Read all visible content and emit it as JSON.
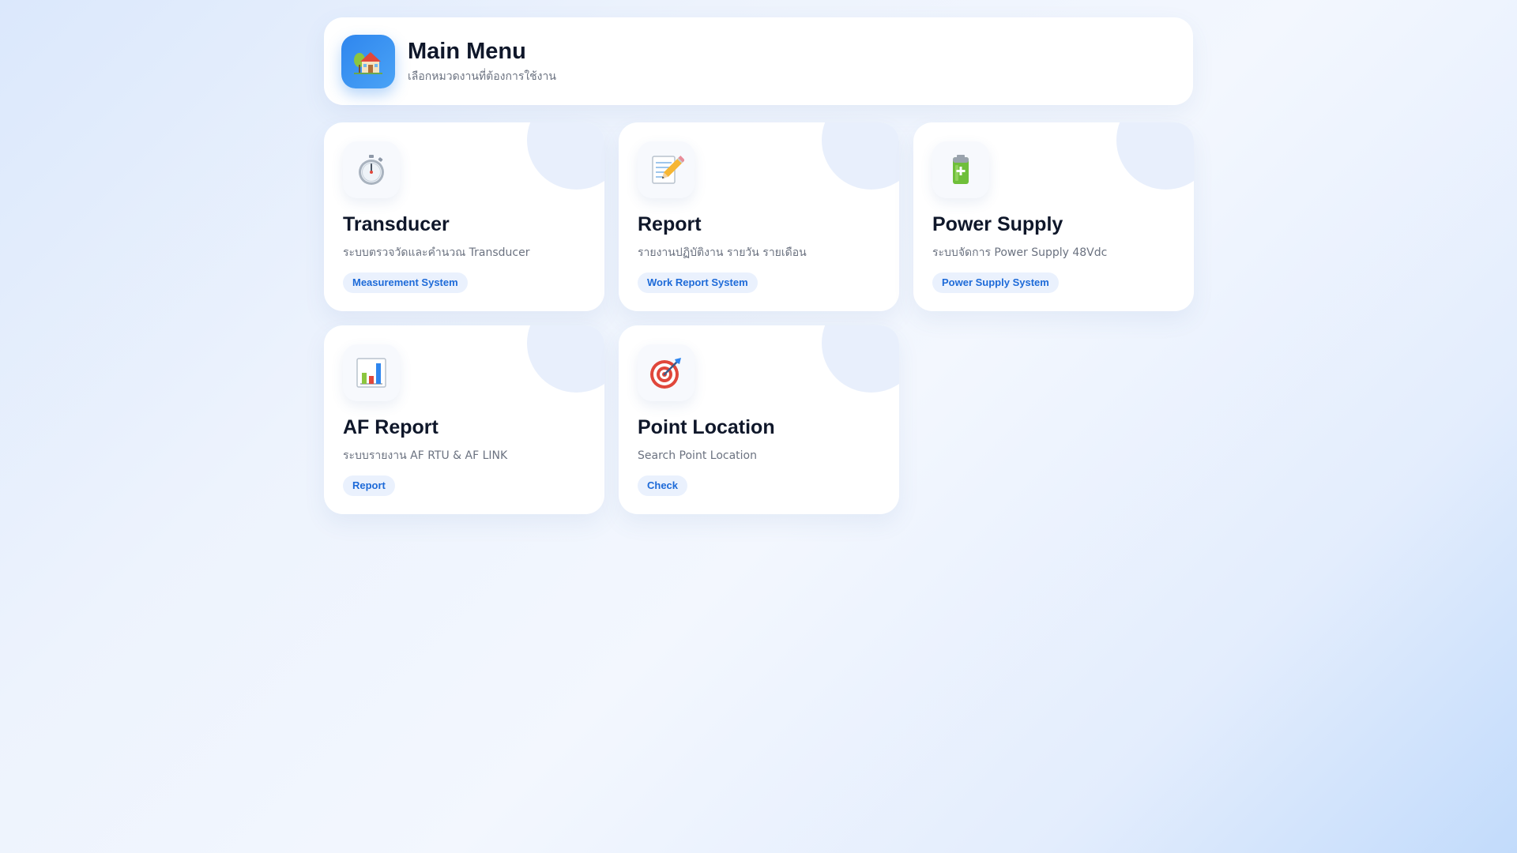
{
  "header": {
    "icon": "house-icon",
    "title": "Main Menu",
    "subtitle": "เลือกหมวดงานที่ต้องการใช้งาน"
  },
  "cards": [
    {
      "icon": "stopwatch-icon",
      "title": "Transducer",
      "description": "ระบบตรวจวัดและคำนวณ Transducer",
      "badge": "Measurement System"
    },
    {
      "icon": "memo-pencil-icon",
      "title": "Report",
      "description": "รายงานปฏิบัติงาน รายวัน รายเดือน",
      "badge": "Work Report System"
    },
    {
      "icon": "battery-icon",
      "title": "Power Supply",
      "description": "ระบบจัดการ Power Supply 48Vdc",
      "badge": "Power Supply System"
    },
    {
      "icon": "bar-chart-icon",
      "title": "AF Report",
      "description": "ระบบรายงาน AF RTU & AF LINK",
      "badge": "Report"
    },
    {
      "icon": "target-icon",
      "title": "Point Location",
      "description": "Search Point Location",
      "badge": "Check"
    }
  ],
  "colors": {
    "accent": "#2f86ee",
    "badge_text": "#1d6ad8",
    "badge_bg": "#eaf1fd",
    "title": "#0f172a",
    "muted": "#6b7280"
  }
}
